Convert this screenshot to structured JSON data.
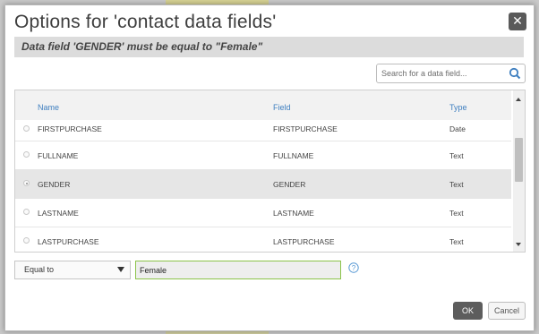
{
  "dialog": {
    "title": "Options for 'contact data fields'",
    "close_label": "✕",
    "condition_text": "Data field 'GENDER' must be equal to \"Female\""
  },
  "search": {
    "placeholder": "Search for a data field..."
  },
  "table": {
    "headers": {
      "name": "Name",
      "field": "Field",
      "type": "Type"
    },
    "rows": [
      {
        "name": "FIRSTPURCHASE",
        "field": "FIRSTPURCHASE",
        "type": "Date",
        "selected": false
      },
      {
        "name": "FULLNAME",
        "field": "FULLNAME",
        "type": "Text",
        "selected": false
      },
      {
        "name": "GENDER",
        "field": "GENDER",
        "type": "Text",
        "selected": true
      },
      {
        "name": "LASTNAME",
        "field": "LASTNAME",
        "type": "Text",
        "selected": false
      },
      {
        "name": "LASTPURCHASE",
        "field": "LASTPURCHASE",
        "type": "Text",
        "selected": false
      }
    ]
  },
  "filter": {
    "operator": "Equal to",
    "value": "Female"
  },
  "buttons": {
    "ok": "OK",
    "cancel": "Cancel"
  },
  "icons": {
    "search": "search-icon",
    "help": "help-icon",
    "close": "close-icon",
    "dropdown": "chevron-down-icon"
  },
  "colors": {
    "accent_blue": "#3f7fc0",
    "input_focus": "#8bc34a",
    "ok_button": "#5d5d5d"
  }
}
